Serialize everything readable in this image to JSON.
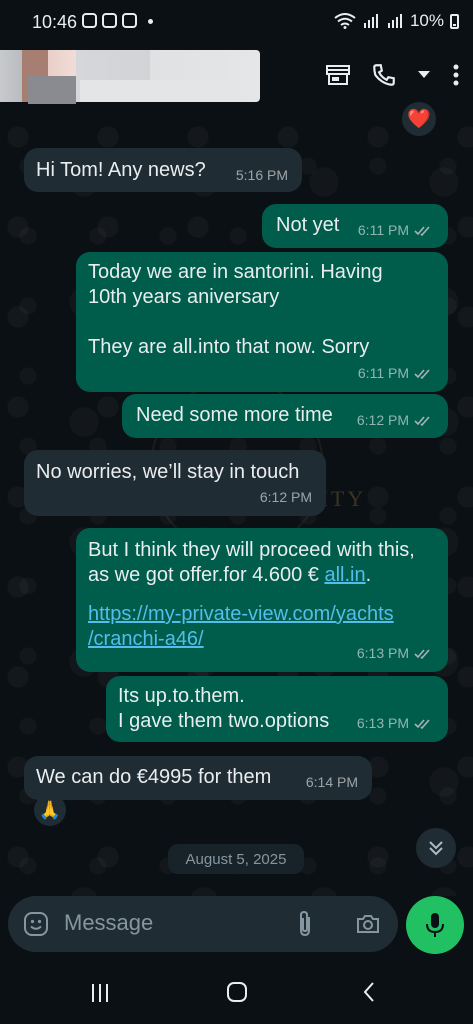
{
  "status": {
    "time": "10:46",
    "battery": "10%"
  },
  "chat": {
    "reaction_emoji": "❤️",
    "messages": [
      {
        "dir": "in",
        "text": "Hi Tom! Any news?",
        "time": "5:16 PM"
      },
      {
        "dir": "out",
        "text": "Not yet",
        "time": "6:11 PM"
      },
      {
        "dir": "out",
        "text": "Today we are in santorini. Having\n10th years aniversary\n\nThey are all.into that now. Sorry",
        "time": "6:11 PM"
      },
      {
        "dir": "out",
        "text": "Need some more time",
        "time": "6:12 PM"
      },
      {
        "dir": "in",
        "text": "No worries, we’ll stay in touch",
        "time": "6:12 PM"
      },
      {
        "dir": "out",
        "text_part1": "But I think they will proceed with this,\nas we got offer.for 4.600 € ",
        "link1": "all.in",
        "text_part2": ".",
        "link2": "https://my-private-view.com/yachts\n/cranchi-a46/",
        "time": "6:13 PM"
      },
      {
        "dir": "out",
        "text": "Its up.to.them.\nI gave them two.options",
        "time": "6:13 PM"
      },
      {
        "dir": "in",
        "text": "We can do €4995 for them",
        "time": "6:14 PM"
      }
    ],
    "emoji_reaction_last": "🙏",
    "date_chip": "August 5, 2025",
    "watermark": "XTREME SECURITY"
  },
  "composer": {
    "placeholder": "Message"
  },
  "colors": {
    "incoming": "#202c33",
    "outgoing": "#005c4b",
    "accent": "#21c063",
    "link": "#53bdeb"
  }
}
